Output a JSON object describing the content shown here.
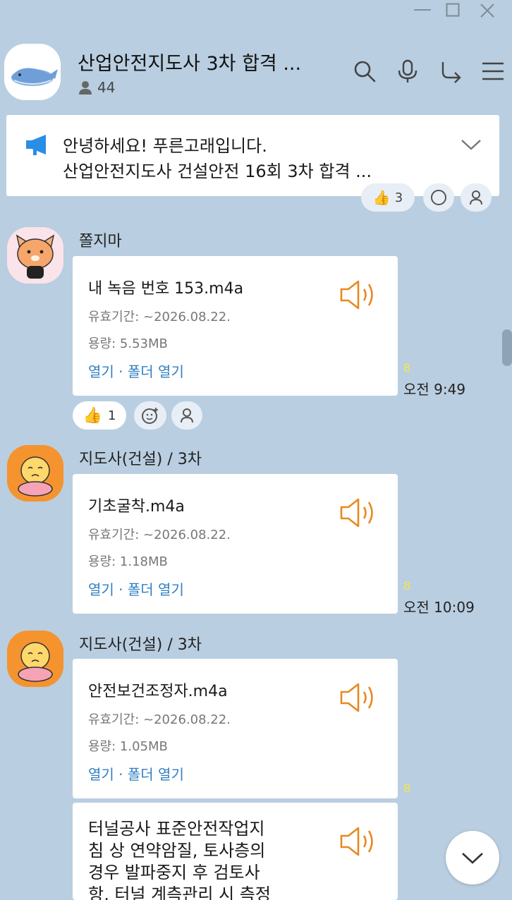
{
  "room": {
    "title": "산업안전지도사 3차 합격 ...",
    "member_count": "44"
  },
  "notice": {
    "line1": "안녕하세요! 푸른고래입니다.",
    "line2": "산업안전지도사 건설안전 16회 3차 합격 ..."
  },
  "top_reactions": {
    "thumbs_count": "3"
  },
  "messages": [
    {
      "sender": "쫄지마",
      "file_name": "내 녹음 번호 153.m4a",
      "expiry": "유효기간: ~2026.08.22.",
      "size": "용량: 5.53MB",
      "open": "열기",
      "sep": "·",
      "open_folder": "폴더 열기",
      "unread": "8",
      "time": "오전 9:49",
      "thumbs_count": "1"
    },
    {
      "sender": "지도사(건설) / 3차",
      "file_name": "기초굴착.m4a",
      "expiry": "유효기간: ~2026.08.22.",
      "size": "용량: 1.18MB",
      "open": "열기",
      "sep": "·",
      "open_folder": "폴더 열기",
      "unread": "8",
      "time": "오전 10:09"
    },
    {
      "sender": "지도사(건설) / 3차",
      "file_name": "안전보건조정자.m4a",
      "expiry": "유효기간: ~2026.08.22.",
      "size": "용량: 1.05MB",
      "open": "열기",
      "sep": "·",
      "open_folder": "폴더 열기",
      "unread": "8"
    },
    {
      "text_lines": [
        "터널공사 표준안전작업지",
        "침 상 연약암질, 토사층의",
        "경우 발파중지 후 검토사",
        "항, 터널 계측관리 시 측정"
      ]
    }
  ],
  "icons": {
    "minimize": "minimize-icon",
    "maximize": "maximize-icon",
    "close": "close-icon",
    "search": "search-icon",
    "mic": "microphone-icon",
    "share": "share-icon",
    "menu": "menu-icon",
    "notice": "megaphone-icon",
    "expand": "chevron-down-icon",
    "person": "person-icon",
    "speaker": "speaker-icon",
    "emoji_add": "emoji-add-icon",
    "scroll_down": "chevron-down-icon"
  },
  "colors": {
    "background": "#b9cee0",
    "link": "#2f7fc1",
    "speaker": "#e8891f",
    "unread": "#f5e64a",
    "notice_icon": "#2a8de6"
  }
}
